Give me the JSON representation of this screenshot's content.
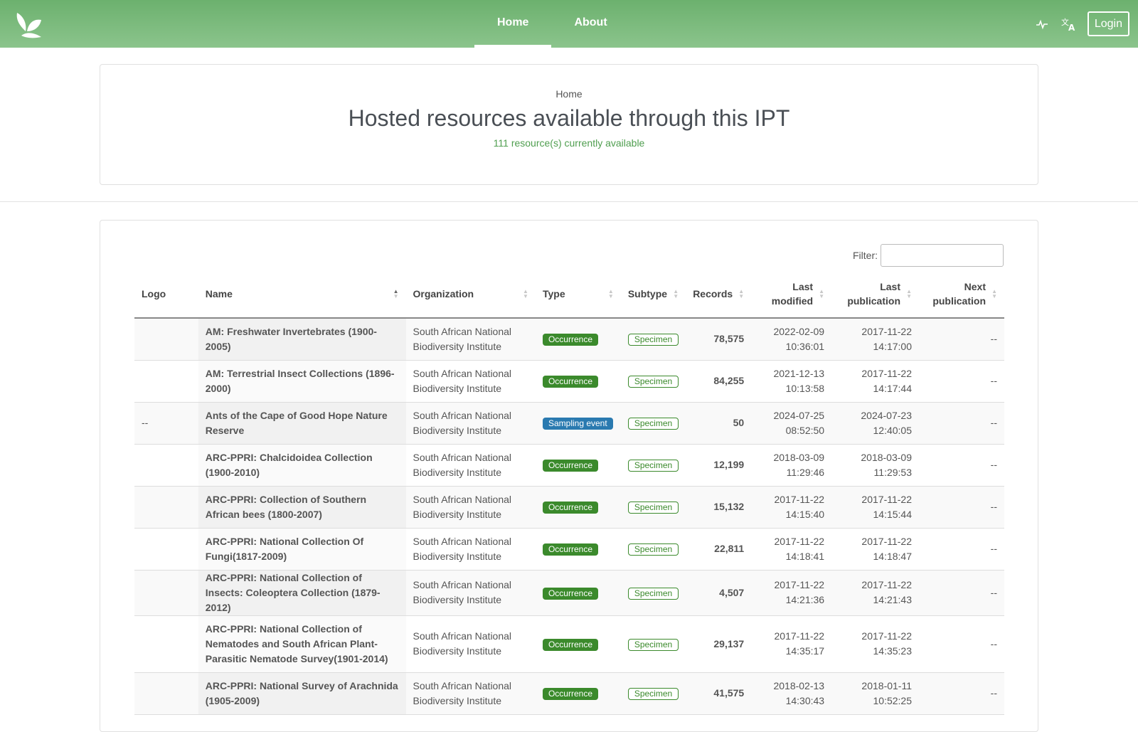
{
  "nav": {
    "tabs": [
      {
        "label": "Home"
      },
      {
        "label": "About"
      }
    ],
    "login_label": "Login",
    "icons": [
      "logo-icon",
      "health-icon",
      "translate-icon"
    ]
  },
  "header": {
    "breadcrumb": "Home",
    "title": "Hosted resources available through this IPT",
    "count": "111 resource(s) currently available"
  },
  "filter": {
    "label": "Filter:",
    "value": ""
  },
  "table": {
    "columns": [
      {
        "label": "Logo"
      },
      {
        "label": "Name"
      },
      {
        "label": "Organization"
      },
      {
        "label": "Type"
      },
      {
        "label": "Subtype"
      },
      {
        "label": "Records"
      },
      {
        "label1": "Last",
        "label2": "modified"
      },
      {
        "label1": "Last",
        "label2": "publication"
      },
      {
        "label1": "Next",
        "label2": "publication"
      }
    ],
    "rows": [
      {
        "logo": "",
        "name": "AM: Freshwater Invertebrates (1900-2005)",
        "org1": "South African National",
        "org2": "Biodiversity Institute",
        "type": "Occurrence",
        "subtype": "Specimen",
        "records": "78,575",
        "mod1": "2022-02-09",
        "mod2": "10:36:01",
        "pub1": "2017-11-22",
        "pub2": "14:17:00",
        "next": "--"
      },
      {
        "logo": "",
        "name": "AM: Terrestrial Insect Collections (1896-2000)",
        "org1": "South African National",
        "org2": "Biodiversity Institute",
        "type": "Occurrence",
        "subtype": "Specimen",
        "records": "84,255",
        "mod1": "2021-12-13",
        "mod2": "10:13:58",
        "pub1": "2017-11-22",
        "pub2": "14:17:44",
        "next": "--"
      },
      {
        "logo": "--",
        "name": "Ants of the Cape of Good Hope Nature Reserve",
        "org1": "South African National",
        "org2": "Biodiversity Institute",
        "type": "Sampling event",
        "subtype": "Specimen",
        "records": "50",
        "mod1": "2024-07-25",
        "mod2": "08:52:50",
        "pub1": "2024-07-23",
        "pub2": "12:40:05",
        "next": "--"
      },
      {
        "logo": "",
        "name": "ARC-PPRI: Chalcidoidea Collection (1900-2010)",
        "org1": "South African National",
        "org2": "Biodiversity Institute",
        "type": "Occurrence",
        "subtype": "Specimen",
        "records": "12,199",
        "mod1": "2018-03-09",
        "mod2": "11:29:46",
        "pub1": "2018-03-09",
        "pub2": "11:29:53",
        "next": "--"
      },
      {
        "logo": "",
        "name": "ARC-PPRI: Collection of Southern African bees (1800-2007)",
        "org1": "South African National",
        "org2": "Biodiversity Institute",
        "type": "Occurrence",
        "subtype": "Specimen",
        "records": "15,132",
        "mod1": "2017-11-22",
        "mod2": "14:15:40",
        "pub1": "2017-11-22",
        "pub2": "14:15:44",
        "next": "--"
      },
      {
        "logo": "",
        "name": "ARC-PPRI: National Collection Of Fungi(1817-2009)",
        "org1": "South African National",
        "org2": "Biodiversity Institute",
        "type": "Occurrence",
        "subtype": "Specimen",
        "records": "22,811",
        "mod1": "2017-11-22",
        "mod2": "14:18:41",
        "pub1": "2017-11-22",
        "pub2": "14:18:47",
        "next": "--"
      },
      {
        "logo": "",
        "name": "ARC-PPRI: National Collection of Insects: Coleoptera Collection (1879-2012)",
        "org1": "South African National",
        "org2": "Biodiversity Institute",
        "type": "Occurrence",
        "subtype": "Specimen",
        "records": "4,507",
        "mod1": "2017-11-22",
        "mod2": "14:21:36",
        "pub1": "2017-11-22",
        "pub2": "14:21:43",
        "next": "--"
      },
      {
        "logo": "",
        "name": "ARC-PPRI: National Collection of Nematodes and South African Plant-Parasitic Nematode Survey(1901-2014)",
        "org1": "South African National",
        "org2": "Biodiversity Institute",
        "type": "Occurrence",
        "subtype": "Specimen",
        "records": "29,137",
        "mod1": "2017-11-22",
        "mod2": "14:35:17",
        "pub1": "2017-11-22",
        "pub2": "14:35:23",
        "next": "--"
      },
      {
        "logo": "",
        "name": "ARC-PPRI: National Survey of Arachnida (1905-2009)",
        "org1": "South African National",
        "org2": "Biodiversity Institute",
        "type": "Occurrence",
        "subtype": "Specimen",
        "records": "41,575",
        "mod1": "2018-02-13",
        "mod2": "14:30:43",
        "pub1": "2018-01-11",
        "pub2": "10:52:25",
        "next": "--"
      }
    ]
  }
}
